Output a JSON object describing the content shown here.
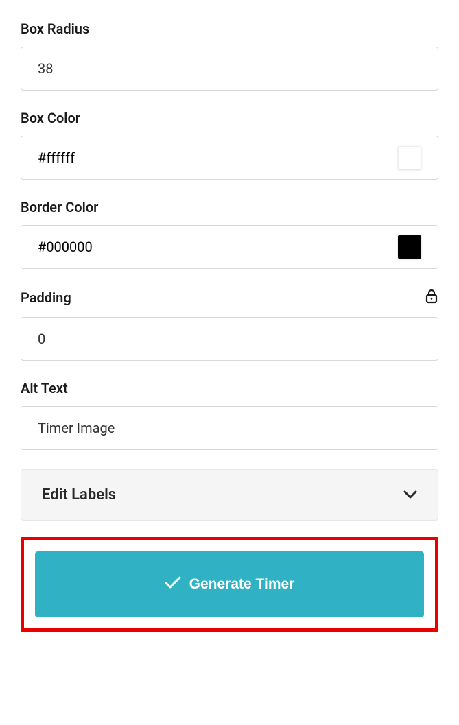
{
  "fields": {
    "box_radius": {
      "label": "Box Radius",
      "value": "38"
    },
    "box_color": {
      "label": "Box Color",
      "value": "#ffffff",
      "swatch": "#ffffff"
    },
    "border_color": {
      "label": "Border Color",
      "value": "#000000",
      "swatch": "#000000"
    },
    "padding": {
      "label": "Padding",
      "value": "0"
    },
    "alt_text": {
      "label": "Alt Text",
      "value": "Timer Image"
    }
  },
  "collapse": {
    "edit_labels": "Edit Labels"
  },
  "button": {
    "generate": "Generate Timer"
  }
}
